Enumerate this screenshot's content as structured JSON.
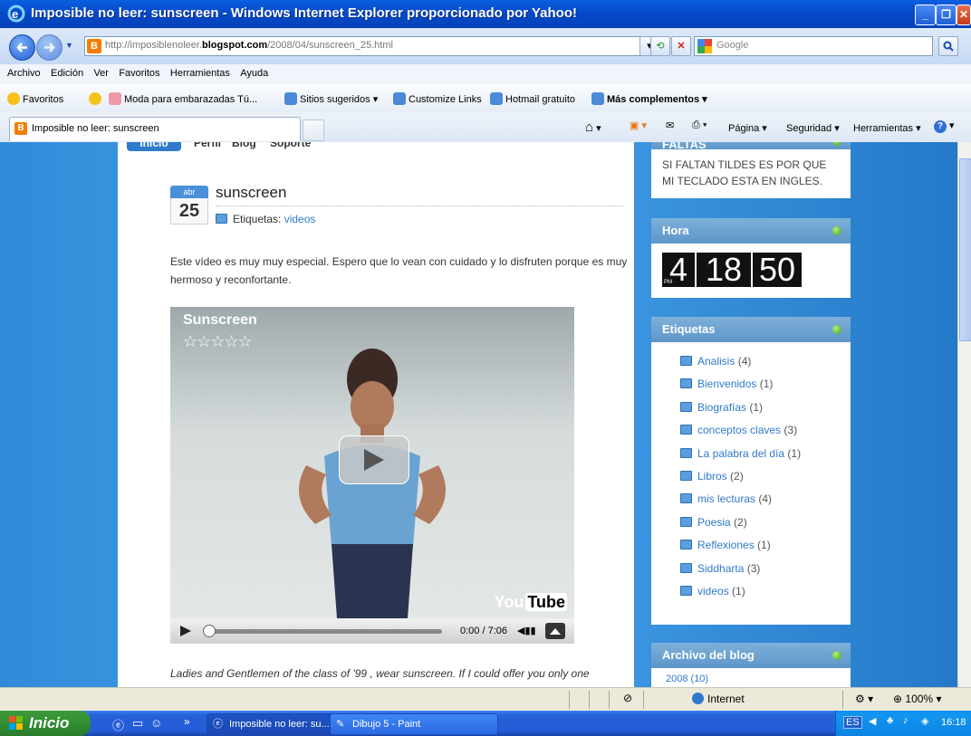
{
  "window": {
    "title": "Imposible no leer: sunscreen - Windows Internet Explorer proporcionado por Yahoo!"
  },
  "address": {
    "url_prefix": "http://imposiblenoleer.",
    "url_domain": "blogspot.com",
    "url_suffix": "/2008/04/sunscreen_25.html",
    "search_placeholder": "Google"
  },
  "menu": [
    "Archivo",
    "Edición",
    "Ver",
    "Favoritos",
    "Herramientas",
    "Ayuda"
  ],
  "favorites": {
    "label": "Favoritos",
    "items": [
      "Moda para embarazadas Tú...",
      "Sitios sugeridos ▾",
      "Customize Links",
      "Hotmail gratuito",
      "Más complementos ▾"
    ]
  },
  "tab": {
    "title": "Imposible no leer: sunscreen"
  },
  "commandbar": {
    "pagina": "Página ▾",
    "seguridad": "Seguridad ▾",
    "herramientas": "Herramientas ▾"
  },
  "blog_nav": [
    "Inicio",
    "Perfil",
    "Blog",
    "Soporte"
  ],
  "post": {
    "month": "abr",
    "day": "25",
    "title": "sunscreen",
    "labels_prefix": "Etiquetas:",
    "label_link": "videos",
    "body": "Este vídeo es muy muy especial. Espero que lo vean con cuidado y lo disfruten porque es muy hermoso y reconfortante.",
    "quote": "Ladies and Gentlemen of the class of '99 , wear sunscreen. If I could offer you only one"
  },
  "video": {
    "title": "Sunscreen",
    "stars": "☆☆☆☆☆",
    "time": "0:00 / 7:06",
    "logo_you": "You",
    "logo_tube": "Tube"
  },
  "sidebar": {
    "faltas": {
      "title": "FALTAS",
      "text": "SI FALTAN TILDES ES POR QUE MI TECLADO ESTA EN INGLES."
    },
    "hora": {
      "title": "Hora",
      "digits": [
        "4",
        "18",
        "50"
      ],
      "pm": "PM"
    },
    "etiquetas": {
      "title": "Etiquetas",
      "items": [
        {
          "name": "Analisis",
          "count": "(4)"
        },
        {
          "name": "Bienvenidos",
          "count": "(1)"
        },
        {
          "name": "Biografías",
          "count": "(1)"
        },
        {
          "name": "conceptos claves",
          "count": "(3)"
        },
        {
          "name": "La palabra del día",
          "count": "(1)"
        },
        {
          "name": "Libros",
          "count": "(2)"
        },
        {
          "name": "mis lecturas",
          "count": "(4)"
        },
        {
          "name": "Poesia",
          "count": "(2)"
        },
        {
          "name": "Reflexiones",
          "count": "(1)"
        },
        {
          "name": "Siddharta",
          "count": "(3)"
        },
        {
          "name": "videos",
          "count": "(1)"
        }
      ]
    },
    "archivo": {
      "title": "Archivo del blog",
      "first_year": "2008 (10)"
    }
  },
  "status": {
    "zone": "Internet",
    "zoom": "100%"
  },
  "taskbar": {
    "start": "Inicio",
    "items": [
      "Imposible no leer: su...",
      "Dibujo 5 - Paint"
    ],
    "lang": "ES",
    "time": "16:18"
  }
}
